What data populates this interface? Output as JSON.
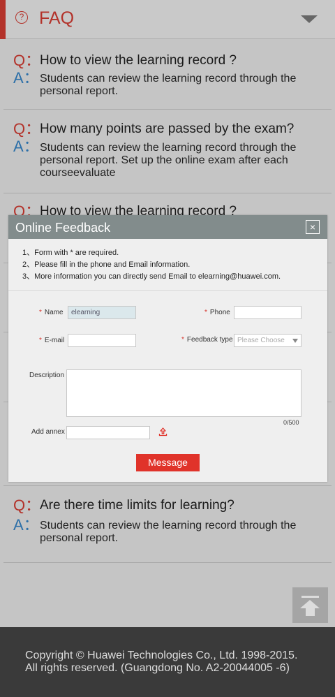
{
  "header": {
    "title": "FAQ",
    "help_icon": "?",
    "accent": "#b3322a"
  },
  "faq_items": [
    {
      "q_mark": "Q：",
      "a_mark": "A：",
      "question": "How to view the learning record ?",
      "answer": "Students can review the learning record through the personal report."
    },
    {
      "q_mark": "Q：",
      "a_mark": "A：",
      "question": "How many points are passed by the exam?",
      "answer": "Students can review the learning record through the personal report. Set up the online exam after each courseevaluate"
    },
    {
      "q_mark": "Q：",
      "question": "How to view the learning record ?"
    },
    {
      "q_mark": "Q：",
      "a_mark": "A：",
      "question": "Are there time limits for learning?",
      "answer": "Students can review the learning record through the personal report."
    }
  ],
  "modal": {
    "title": "Online Feedback",
    "close_glyph": "×",
    "notes": [
      "1、Form with * are required.",
      "2、Please fill in the phone and Email information.",
      "3、More information you can directly send Email to elearning@huawei.com."
    ],
    "required_mark": "*",
    "name_label": "Name",
    "name_value": "elearning",
    "phone_label": "Phone",
    "phone_value": "",
    "email_label": "E-mail",
    "email_value": "",
    "type_label": "Feedback type",
    "type_value": "Please Choose",
    "description_label": "Description",
    "description_value": "",
    "counter": "0/500",
    "annex_label": "Add annex",
    "annex_value": "",
    "message_button": "Message",
    "button_color": "#e0332a"
  },
  "footer": {
    "line1": "Copyright © Huawei Technologies Co., Ltd. 1998-2015.",
    "line2": "All rights reserved. (Guangdong No. A2-20044005 -6)"
  }
}
